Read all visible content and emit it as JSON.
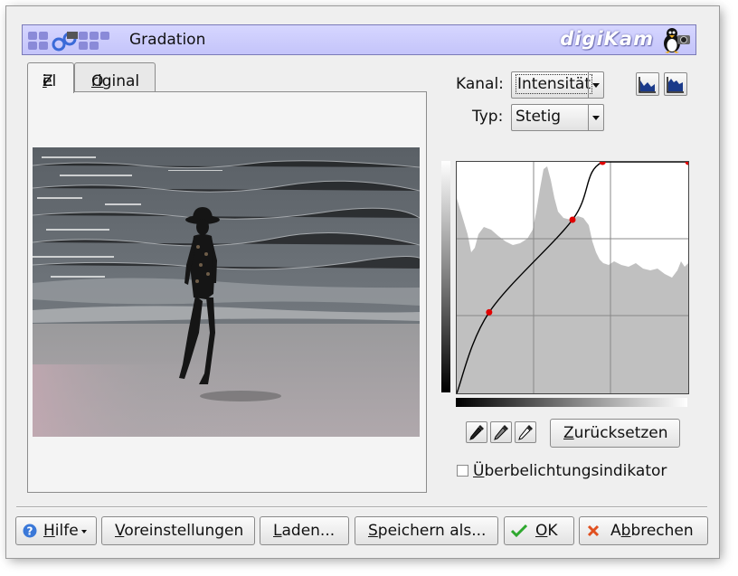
{
  "titlebar": {
    "title": "Gradation",
    "brand": "digiKam"
  },
  "tabs": [
    {
      "pre": "Z",
      "u": "i",
      "post": "el"
    },
    {
      "pre": "",
      "u": "O",
      "post": "riginal"
    }
  ],
  "controls": {
    "kanal_label": "Kanal:",
    "kanal_value": "Intensität",
    "typ_label": "Typ:",
    "typ_value": "Stetig"
  },
  "curve": {
    "points": [
      [
        0.14,
        0.35
      ],
      [
        0.5,
        0.75
      ],
      [
        0.63,
        1.0
      ],
      [
        1.0,
        1.0
      ]
    ]
  },
  "reset_button": {
    "pre": "",
    "u": "Z",
    "post": "urücksetzen"
  },
  "overexposure": {
    "pre": "",
    "u": "Ü",
    "post": "berbelichtungsindikator"
  },
  "buttons": {
    "help": {
      "pre": "",
      "u": "H",
      "post": "ilfe"
    },
    "presets": {
      "pre": "",
      "u": "V",
      "post": "oreinstellungen"
    },
    "load": {
      "pre": "",
      "u": "L",
      "post": "aden..."
    },
    "save_as": {
      "pre": "",
      "u": "S",
      "post": "peichern als..."
    },
    "ok": {
      "pre": "",
      "u": "O",
      "post": "K"
    },
    "cancel": {
      "pre": "A",
      "u": "b",
      "post": "brechen"
    }
  },
  "colors": {
    "curve_point": "#e00000",
    "accent_ok": "#2ea82e",
    "accent_cancel": "#e05020",
    "help_icon": "#3a78d8",
    "histogram": "#c0c0c0"
  },
  "icons": [
    "digikam-app-icon",
    "tux-camera-icon",
    "linear-histogram-icon",
    "log-histogram-icon",
    "black-picker-icon",
    "gray-picker-icon",
    "white-picker-icon",
    "help-icon",
    "ok-check-icon",
    "cancel-x-icon"
  ]
}
